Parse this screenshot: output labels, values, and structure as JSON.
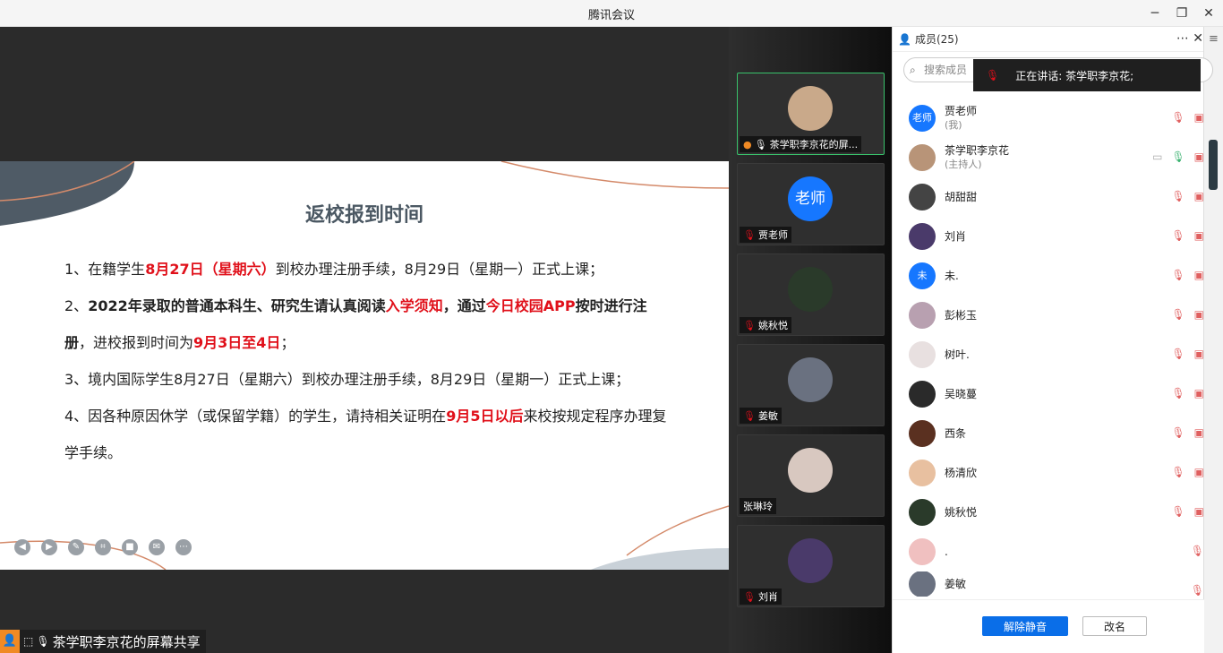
{
  "window": {
    "title": "腾讯会议",
    "minimize": "─",
    "restore": "❐",
    "close": "✕"
  },
  "slide": {
    "title": "返校报到时间",
    "p1": {
      "a": "1、在籍学生",
      "b": "8月27日（星期六）",
      "c": "到校办理注册手续，8月29日（星期一）正式上课；"
    },
    "p2": {
      "a": "2、",
      "b": "2022年录取的普通本科生、研究生请认真阅读",
      "c": "入学须知",
      "d": "，通过",
      "e": "今日校园APP",
      "f": "按时进行注册",
      "g": "，进校报到时间为",
      "h": "9月3日至4日",
      "i": "；"
    },
    "p3": "3、境内国际学生8月27日（星期六）到校办理注册手续，8月29日（星期一）正式上课；",
    "p4": {
      "a": "4、因各种原因休学（或保留学籍）的学生，请持相关证明在",
      "b": "9月5日以后",
      "c": "来校按规定程序办理复学手续。"
    },
    "tools": [
      "◀",
      "▶",
      "✎",
      "⌗",
      "■",
      "✉",
      "⋯"
    ]
  },
  "share_label": "茶学职李京花的屏幕共享",
  "tiles": [
    {
      "name": "茶学职李京花的屏...",
      "color": "#c9a98a",
      "active": true,
      "muted": false
    },
    {
      "name": "贾老师",
      "color": "#1677ff",
      "text": "老师",
      "active": false,
      "muted": true
    },
    {
      "name": "姚秋悦",
      "color": "#2a3a2a",
      "active": false,
      "muted": true
    },
    {
      "name": "姜敏",
      "color": "#6a7180",
      "active": false,
      "muted": true
    },
    {
      "name": "张琳玲",
      "color": "#d8c8c0",
      "active": false,
      "muted": false
    },
    {
      "name": "刘肖",
      "color": "#4a3a6a",
      "active": false,
      "muted": true
    }
  ],
  "panel": {
    "header": "成员(25)",
    "search_placeholder": "搜索成员",
    "speaking": "正在讲话: 茶学职李京花;",
    "members": [
      {
        "name": "贾老师",
        "role": "(我)",
        "color": "#1677ff",
        "text": "老师"
      },
      {
        "name": "茶学职李京花",
        "role": "(主持人)",
        "color": "#b89478",
        "mic_on": true
      },
      {
        "name": "胡甜甜",
        "color": "#444"
      },
      {
        "name": "刘肖",
        "color": "#4a3a6a"
      },
      {
        "name": "未.",
        "color": "#1677ff",
        "text": "未"
      },
      {
        "name": "彭彬玉",
        "color": "#b8a0b0"
      },
      {
        "name": "树叶.",
        "color": "#e8e0e0"
      },
      {
        "name": "吴晓蔓",
        "color": "#2a2a2a"
      },
      {
        "name": "西条",
        "color": "#5a3020"
      },
      {
        "name": "杨清欣",
        "color": "#e8c0a0"
      },
      {
        "name": "姚秋悦",
        "color": "#2a3a2a"
      },
      {
        "name": ".",
        "color": "#f0c0c0"
      },
      {
        "name": "姜敏",
        "color": "#6a7180"
      }
    ],
    "unmute_button": "解除静音",
    "rename_button": "改名"
  }
}
